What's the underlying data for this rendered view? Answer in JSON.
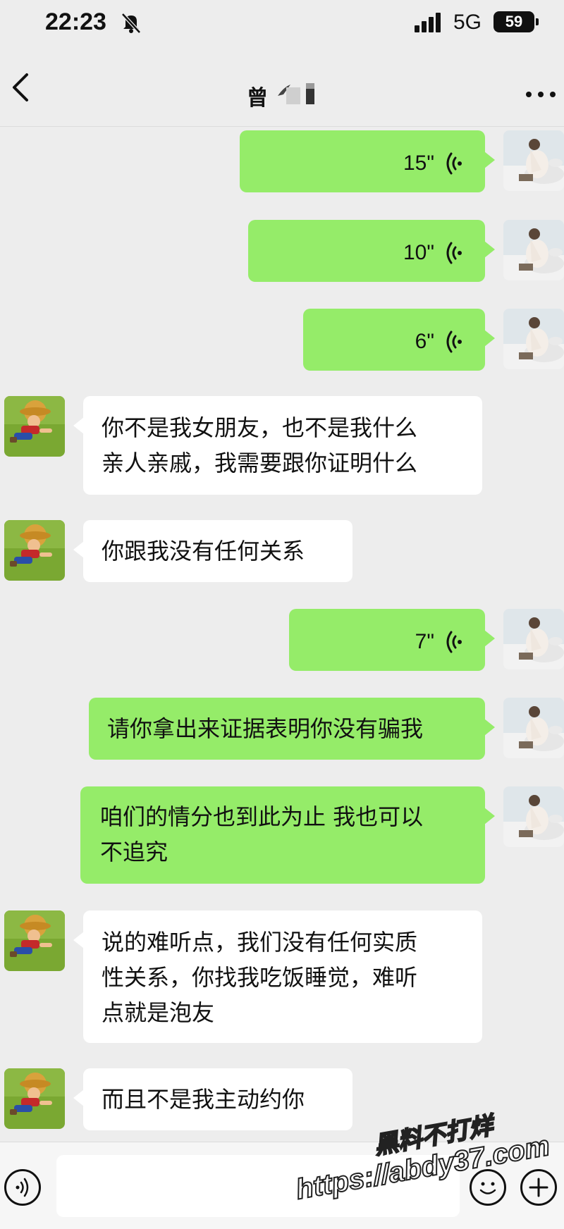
{
  "status_bar": {
    "time": "22:23",
    "network": "5G",
    "battery": "59",
    "icons": [
      "mute-bell-icon",
      "signal-bars-icon"
    ]
  },
  "nav": {
    "title": "曾",
    "back_icon": "chevron-left-icon",
    "more_icon": "more-dots-icon"
  },
  "messages": [
    {
      "side": "sent",
      "type": "voice",
      "duration": "15\""
    },
    {
      "side": "sent",
      "type": "voice",
      "duration": "10\""
    },
    {
      "side": "sent",
      "type": "voice",
      "duration": "6\""
    },
    {
      "side": "received",
      "type": "text",
      "lines": [
        "你不是我女朋友，也不是我什么",
        "亲人亲戚，我需要跟你证明什么"
      ]
    },
    {
      "side": "received",
      "type": "text",
      "lines": [
        "你跟我没有任何关系"
      ]
    },
    {
      "side": "sent",
      "type": "voice",
      "duration": "7\""
    },
    {
      "side": "sent",
      "type": "text",
      "lines": [
        "请你拿出来证据表明你没有骗我"
      ]
    },
    {
      "side": "sent",
      "type": "text",
      "lines": [
        "咱们的情分也到此为止 我也可以",
        "不追究"
      ]
    },
    {
      "side": "received",
      "type": "text",
      "lines": [
        "说的难听点，我们没有任何实质",
        "性关系，你找我吃饭睡觉，难听",
        "点就是泡友"
      ]
    },
    {
      "side": "received",
      "type": "text",
      "lines": [
        "而且不是我主动约你"
      ]
    }
  ],
  "input_bar": {
    "placeholder": "",
    "icons": [
      "voice-toggle-icon",
      "emoji-icon",
      "plus-icon"
    ]
  },
  "watermark": {
    "line1": "黑料不打烊",
    "line2": "https://abdy37.com"
  },
  "colors": {
    "background": "#ededed",
    "sent_bubble": "#95ec69",
    "received_bubble": "#ffffff"
  }
}
